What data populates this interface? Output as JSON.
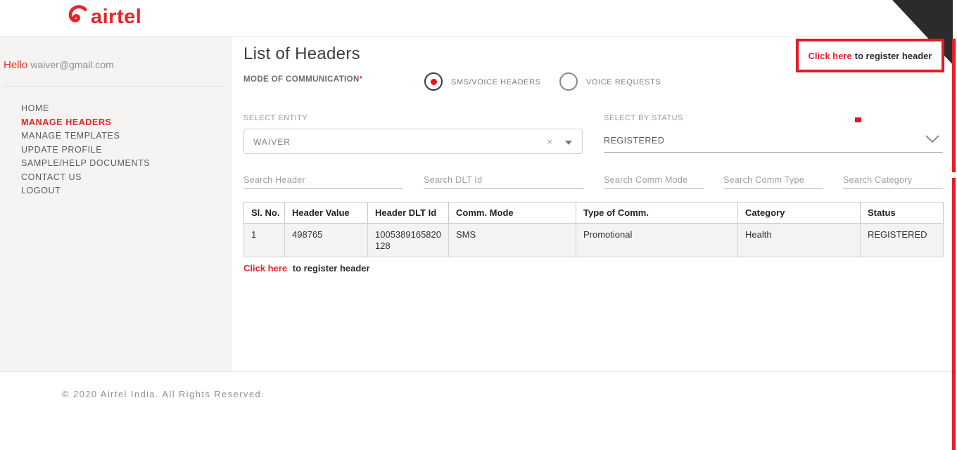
{
  "brand": {
    "logo_text": "airtel"
  },
  "sidebar": {
    "greeting": "Hello",
    "email": "waiver@gmail.com",
    "items": [
      {
        "label": "HOME",
        "active": false
      },
      {
        "label": "MANAGE HEADERS",
        "active": true
      },
      {
        "label": "MANAGE TEMPLATES",
        "active": false
      },
      {
        "label": "UPDATE PROFILE",
        "active": false
      },
      {
        "label": "SAMPLE/HELP DOCUMENTS",
        "active": false
      },
      {
        "label": "CONTACT US",
        "active": false
      },
      {
        "label": "LOGOUT",
        "active": false
      }
    ]
  },
  "main": {
    "title": "List of Headers",
    "mode_of_communication": {
      "label": "MODE OF COMMUNICATION",
      "required_mark": "*",
      "options": [
        {
          "label": "SMS/VOICE HEADERS",
          "selected": true
        },
        {
          "label": "VOICE REQUESTS",
          "selected": false
        }
      ]
    },
    "register_link_top": {
      "highlight": "Click here",
      "rest": "to register header"
    },
    "entity": {
      "label": "SELECT ENTITY",
      "value": "WAIVER",
      "clear_icon": "×"
    },
    "status": {
      "label": "SELECT BY STATUS",
      "value": "REGISTERED"
    },
    "search_fields": [
      {
        "placeholder": "Search Header"
      },
      {
        "placeholder": "Search DLT Id"
      },
      {
        "placeholder": "Search Comm Mode"
      },
      {
        "placeholder": "Search Comm Type"
      },
      {
        "placeholder": "Search Category"
      }
    ],
    "table": {
      "columns": [
        "Sl. No.",
        "Header Value",
        "Header DLT Id",
        "Comm. Mode",
        "Type of Comm.",
        "Category",
        "Status"
      ],
      "rows": [
        [
          "1",
          "498765",
          "1005389165820128",
          "SMS",
          "Promotional",
          "Health",
          "REGISTERED"
        ]
      ]
    },
    "register_link_bottom": {
      "highlight": "Click here",
      "rest": "to register header"
    }
  },
  "footer": {
    "copyright": "© 2020 Airtel India. All Rights Reserved."
  },
  "colors": {
    "accent_red": "#e8232a",
    "marker_red": "#ec1c24",
    "corner_black": "#2b2b2b",
    "sidebar_bg": "#f5f4f2",
    "row_bg": "#f3f3f3"
  }
}
